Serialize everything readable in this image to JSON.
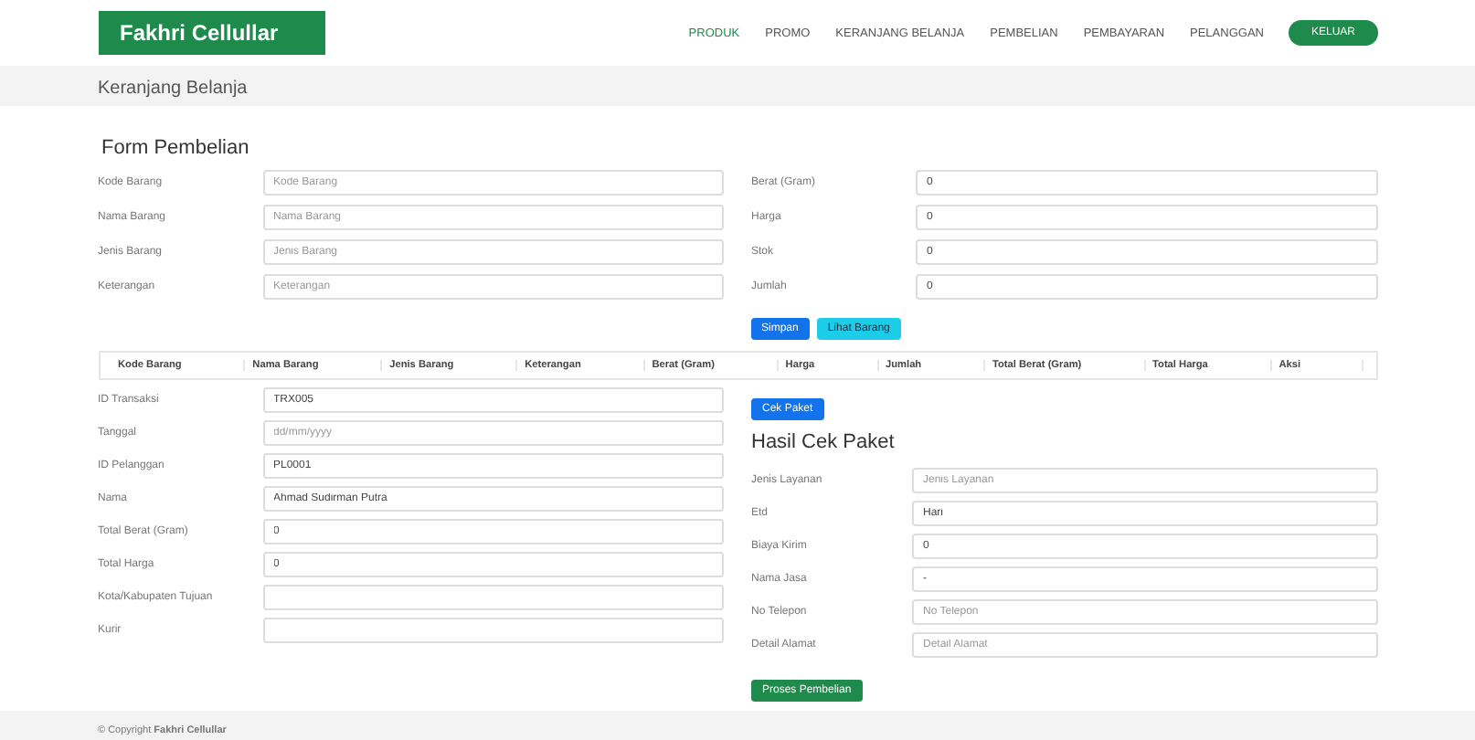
{
  "brand": "Fakhri Cellullar",
  "nav": [
    {
      "label": "PRODUK",
      "selected": true
    },
    {
      "label": "PROMO",
      "selected": false
    },
    {
      "label": "KERANJANG BELANJA",
      "selected": false
    },
    {
      "label": "PEMBELIAN",
      "selected": false
    },
    {
      "label": "PEMBAYARAN",
      "selected": false
    },
    {
      "label": "PELANGGAN",
      "selected": false
    }
  ],
  "nav_button": "KELUAR",
  "breadcrumb": "Keranjang Belanja",
  "form_title": "Form Pembelian",
  "item_fields_left": [
    {
      "label": "Kode Barang",
      "placeholder": "Kode Barang"
    },
    {
      "label": "Nama Barang",
      "placeholder": "Nama Barang"
    },
    {
      "label": "Jenis Barang",
      "placeholder": "Jenis Barang"
    },
    {
      "label": "Keterangan",
      "placeholder": "Keterangan"
    }
  ],
  "item_fields_right": [
    {
      "label": "Berat (Gram)",
      "value": "0"
    },
    {
      "label": "Harga",
      "value": "0"
    },
    {
      "label": "Stok",
      "value": "0"
    },
    {
      "label": "Jumlah",
      "value": "0"
    }
  ],
  "buttons": [
    {
      "label": "Simpan",
      "kind": "primary"
    },
    {
      "label": "Lihat Barang",
      "kind": "info"
    }
  ],
  "table": {
    "columns": [
      "Kode Barang",
      "Nama Barang",
      "Jenis Barang",
      "Keterangan",
      "Berat (Gram)",
      "Harga",
      "Jumlah",
      "Total Berat (Gram)",
      "Total Harga",
      "Aksi"
    ]
  },
  "order_fields": [
    {
      "label": "ID Transaksi",
      "value": "TRX005"
    },
    {
      "label": "Tanggal",
      "placeholder": "dd/mm/yyyy"
    },
    {
      "label": "ID Pelanggan",
      "value": "PL0001"
    },
    {
      "label": "Nama",
      "value": "Ahmad Sudirman Putra"
    },
    {
      "label": "Total Berat (Gram)",
      "value": "0"
    },
    {
      "label": "Total Harga",
      "value": "0"
    },
    {
      "label": "Kota/Kabupaten Tujuan"
    },
    {
      "label": "Kurir"
    }
  ],
  "check_button": "Cek Paket",
  "result_title": "Hasil Cek Paket",
  "result_fields": [
    {
      "label": "Jenis Layanan",
      "placeholder": "Jenis Layanan"
    },
    {
      "label": "Etd",
      "value": "Hari"
    },
    {
      "label": "Biaya Kirim",
      "value": "0"
    },
    {
      "label": "Nama Jasa",
      "value": "-"
    },
    {
      "label": "No Telepon",
      "placeholder": "No Telepon"
    },
    {
      "label": "Detail Alamat",
      "placeholder": "Detail Alamat"
    }
  ],
  "submit_button": "Proses Pembelian",
  "footer": "© Copyright **Fakhri Cellullar**"
}
